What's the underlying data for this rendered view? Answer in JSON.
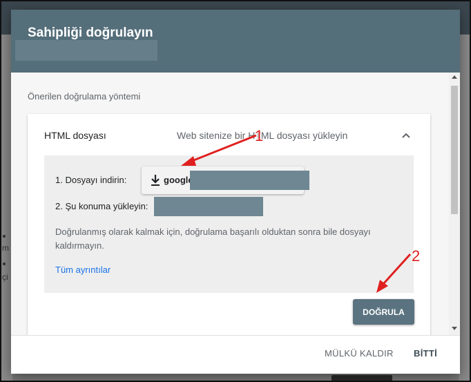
{
  "dialog": {
    "title": "Sahipliği doğrulayın",
    "section_label": "Önerilen doğrulama yöntemi",
    "card": {
      "title": "HTML dosyası",
      "description": "Web sitenize bir HTML dosyası yükleyin",
      "step1_label": "1. Dosyayı indirin:",
      "download_label": "google",
      "step2_label": "2. Şu konuma yükleyin:",
      "note": "Doğrulanmış olarak kalmak için, doğrulama başarılı olduktan sonra bile dosyayı kaldırmayın.",
      "details_link": "Tüm ayrıntılar",
      "verify_button": "DOĞRULA"
    },
    "footer": {
      "remove_button": "MÜLKÜ KALDIR",
      "done_button": "BİTTİ"
    }
  },
  "background": {
    "left_fragments": [
      "m",
      "çi"
    ]
  },
  "annotations": {
    "marker_1": "1",
    "marker_2": "2",
    "color": "#e02020"
  },
  "colors": {
    "header": "#546e7a",
    "verify_button": "#5b7380",
    "link": "#1a73e8"
  },
  "icons": {
    "download": "download-icon",
    "collapse": "chevron-up-icon"
  }
}
